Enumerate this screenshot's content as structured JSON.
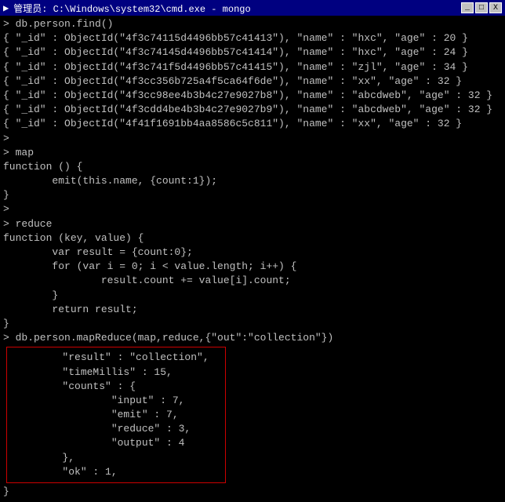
{
  "titleBar": {
    "icon": "cmd-icon",
    "title": "管理员: C:\\Windows\\system32\\cmd.exe - mongo",
    "minimize": "_",
    "maximize": "□",
    "close": "X"
  },
  "terminal": {
    "lines": [
      "> db.person.find()",
      "{ \"_id\" : ObjectId(\"4f3c74115d4496bb57c41413\"), \"name\" : \"hxc\", \"age\" : 20 }",
      "{ \"_id\" : ObjectId(\"4f3c74145d4496bb57c41414\"), \"name\" : \"hxc\", \"age\" : 24 }",
      "{ \"_id\" : ObjectId(\"4f3c741f5d4496bb57c41415\"), \"name\" : \"zjl\", \"age\" : 34 }",
      "{ \"_id\" : ObjectId(\"4f3cc356b725a4f5ca64f6de\"), \"name\" : \"xx\", \"age\" : 32 }",
      "{ \"_id\" : ObjectId(\"4f3cc98ee4b3b4c27e9027b8\"), \"name\" : \"abcdweb\", \"age\" : 32 }",
      "",
      "{ \"_id\" : ObjectId(\"4f3cdd4be4b3b4c27e9027b9\"), \"name\" : \"abcdweb\", \"age\" : 32 }",
      "",
      "{ \"_id\" : ObjectId(\"4f41f1691bb4aa8586c5c811\"), \"name\" : \"xx\", \"age\" : 32 }",
      ">",
      "> map",
      "function () {",
      "        emit(this.name, {count:1});",
      "}",
      ">",
      "> reduce",
      "function (key, value) {",
      "        var result = {count:0};",
      "        for (var i = 0; i < value.length; i++) {",
      "                result.count += value[i].count;",
      "        }",
      "        return result;",
      "}",
      "> db.person.mapReduce(map,reduce,{\"out\":\"collection\"})"
    ],
    "resultBox": {
      "lines": [
        "        \"result\" : \"collection\",",
        "        \"timeMillis\" : 15,",
        "        \"counts\" : {",
        "                \"input\" : 7,",
        "                \"emit\" : 7,",
        "                \"reduce\" : 3,",
        "                \"output\" : 4",
        "        },",
        "        \"ok\" : 1,"
      ]
    },
    "afterBox": "}"
  }
}
